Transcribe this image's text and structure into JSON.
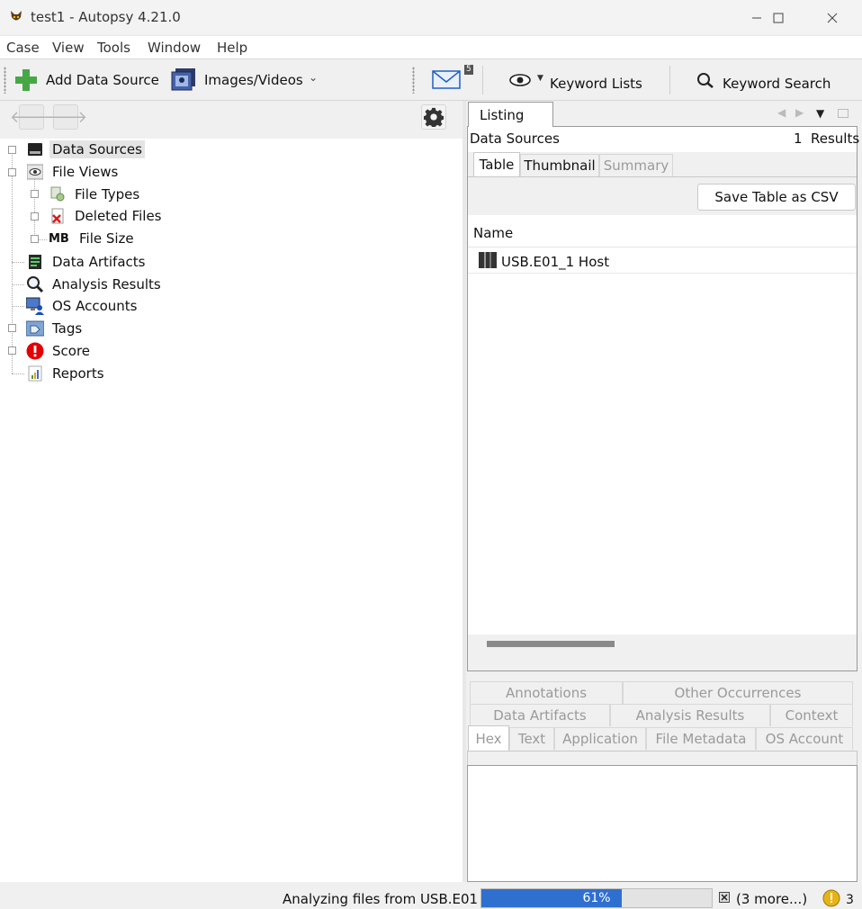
{
  "window": {
    "title": "test1 - Autopsy 4.21.0"
  },
  "menu": [
    "Case",
    "View",
    "Tools",
    "Window",
    "Help"
  ],
  "toolbar": {
    "add_data_source": "Add Data Source",
    "images_videos": "Images/Videos",
    "message_count": "5",
    "keyword_lists": "Keyword Lists",
    "keyword_search": "Keyword Search"
  },
  "tree": [
    {
      "label": "Data Sources",
      "icon": "drive-icon",
      "level": 0,
      "selected": true
    },
    {
      "label": "File Views",
      "icon": "eye-icon",
      "level": 0
    },
    {
      "label": "File Types",
      "icon": "file-types-icon",
      "level": 1
    },
    {
      "label": "Deleted Files",
      "icon": "deleted-file-icon",
      "level": 1
    },
    {
      "label": "File Size",
      "icon": "mb-icon",
      "level": 1
    },
    {
      "label": "Data Artifacts",
      "icon": "artifacts-icon",
      "level": 0
    },
    {
      "label": "Analysis Results",
      "icon": "magnifier-icon",
      "level": 0
    },
    {
      "label": "OS Accounts",
      "icon": "user-computer-icon",
      "level": 0
    },
    {
      "label": "Tags",
      "icon": "tag-icon",
      "level": 0
    },
    {
      "label": "Score",
      "icon": "exclamation-icon",
      "level": 0
    },
    {
      "label": "Reports",
      "icon": "report-icon",
      "level": 0
    }
  ],
  "listing": {
    "tab": "Listing",
    "header": "Data Sources",
    "results_count": "1",
    "results_label": "Results",
    "subtabs": [
      "Table",
      "Thumbnail",
      "Summary"
    ],
    "save_csv": "Save Table as CSV",
    "column": "Name",
    "rows": [
      "USB.E01_1 Host"
    ]
  },
  "content_tabs": {
    "row1": [
      "Annotations",
      "Other Occurrences"
    ],
    "row2": [
      "Data Artifacts",
      "Analysis Results",
      "Context"
    ],
    "row3": [
      "Hex",
      "Text",
      "Application",
      "File Metadata",
      "OS Account"
    ]
  },
  "status": {
    "text": "Analyzing files from USB.E01",
    "progress_percent": 61,
    "progress_label": "61%",
    "more": "(3 more...)",
    "notifications": "3"
  },
  "colors": {
    "progress": "#2f6fd0",
    "accent_green": "#46a845"
  }
}
